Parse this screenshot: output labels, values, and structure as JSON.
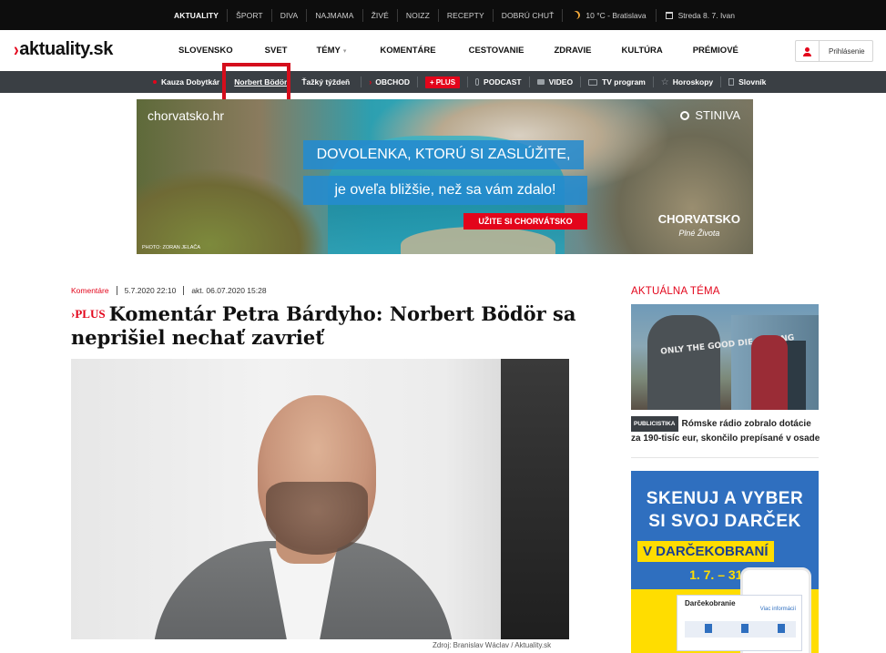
{
  "topbar": {
    "items": [
      "AKTUALITY",
      "ŠPORT",
      "DIVA",
      "NAJMAMA",
      "ŽIVÉ",
      "NOIZZ",
      "RECEPTY",
      "DOBRÚ CHUŤ"
    ],
    "weather": "10 °C - Bratislava",
    "date": "Streda 8. 7. Ivan"
  },
  "header": {
    "logo": "aktuality.sk",
    "nav": [
      "SLOVENSKO",
      "SVET",
      "TÉMY",
      "KOMENTÁRE",
      "CESTOVANIE",
      "ZDRAVIE",
      "KULTÚRA",
      "PRÉMIOVÉ"
    ],
    "login": "Prihlásenie"
  },
  "subnav": {
    "kauza": "Kauza Dobytkár",
    "bodor": "Norbert Bödör",
    "tyzden": "Ťažký týždeň",
    "obchod": "OBCHOD",
    "plus": "PLUS",
    "podcast": "PODCAST",
    "video": "VIDEO",
    "tv": "TV program",
    "horoskopy": "Horoskopy",
    "slovnik": "Slovník"
  },
  "banner": {
    "site": "chorvatsko.hr",
    "brand_top": "STINIVA",
    "headline1": "DOVOLENKA, KTORÚ SI ZASLÚŽITE,",
    "headline2": "je oveľa bližšie, než sa vám zdalo!",
    "cta": "UŽITE SI CHORVÁTSKO",
    "brand": "CHORVATSKO",
    "brand_sub": "Plné Života",
    "photo": "PHOTO: ZORAN JELAČA"
  },
  "article": {
    "category": "Komentáre",
    "published": "5.7.2020 22:10",
    "updated": "akt. 06.07.2020 15:28",
    "plus_tag": "PLUS",
    "title": "Komentár Petra Bárdyho: Norbert Bödör sa neprišiel nechať zavrieť",
    "image_caption": "Zdroj: Branislav Wáclav / Aktuality.sk"
  },
  "sidebar": {
    "heading": "AKTUÁLNA TÉMA",
    "badge": "PUBLICISTIKA",
    "headline": "Rómske rádio zobralo dotácie za 190-tisíc eur, skončilo prepísané v osade",
    "shirt_text": "ONLY THE GOOD DIE STRONG"
  },
  "ad2": {
    "line1": "SKENUJ A VYBER",
    "line2": "SI SVOJ DARČEK",
    "badge": "V DARČEKOBRANÍ",
    "dates": "1. 7. – 31. 7.",
    "card_title": "Darčekobranie",
    "card_link": "Viac informácií"
  },
  "colors": {
    "accent": "#e3051b",
    "topbar_bg": "#0d0d0d",
    "subnav_bg": "#3a3f44",
    "highlight": "#d50e1c"
  }
}
